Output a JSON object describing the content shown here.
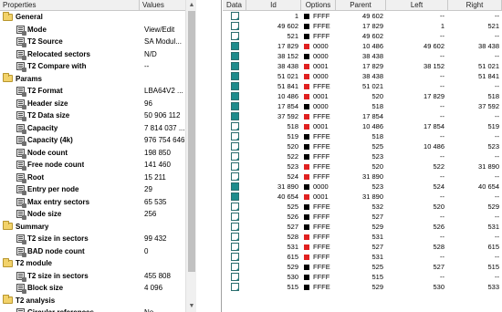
{
  "properties": {
    "header": {
      "col_name": "Properties",
      "col_value": "Values"
    },
    "rows": [
      {
        "kind": "group",
        "label": "General",
        "value": ""
      },
      {
        "kind": "item",
        "label": "Mode",
        "value": "View/Edit"
      },
      {
        "kind": "item",
        "label": "T2 Source",
        "value": "SA Modul..."
      },
      {
        "kind": "item",
        "label": "Relocated sectors",
        "value": "N/D"
      },
      {
        "kind": "item",
        "label": "T2 Compare with",
        "value": "--"
      },
      {
        "kind": "group",
        "label": "Params",
        "value": ""
      },
      {
        "kind": "item",
        "label": "T2 Format",
        "value": "LBA64V2 ..."
      },
      {
        "kind": "item",
        "label": "Header size",
        "value": "96"
      },
      {
        "kind": "item",
        "label": "T2 Data size",
        "value": "50 906 112"
      },
      {
        "kind": "item",
        "label": "Capacity",
        "value": "7 814 037 ..."
      },
      {
        "kind": "item",
        "label": "Capacity (4k)",
        "value": "976 754 646"
      },
      {
        "kind": "item",
        "label": "Node count",
        "value": "198 850"
      },
      {
        "kind": "item",
        "label": "Free node count",
        "value": "141 460"
      },
      {
        "kind": "item",
        "label": "Root",
        "value": "15 211"
      },
      {
        "kind": "item",
        "label": "Entry per node",
        "value": "29"
      },
      {
        "kind": "item",
        "label": "Max entry sectors",
        "value": "65 535"
      },
      {
        "kind": "item",
        "label": "Node size",
        "value": "256"
      },
      {
        "kind": "group",
        "label": "Summary",
        "value": ""
      },
      {
        "kind": "item",
        "label": "T2 size in sectors",
        "value": "99 432"
      },
      {
        "kind": "item",
        "label": "BAD node count",
        "value": "0"
      },
      {
        "kind": "group",
        "label": "T2 module",
        "value": ""
      },
      {
        "kind": "item",
        "label": "T2 size in sectors",
        "value": "455 808"
      },
      {
        "kind": "item",
        "label": "Block size",
        "value": "4 096"
      },
      {
        "kind": "group",
        "label": "T2 analysis",
        "value": ""
      },
      {
        "kind": "item",
        "label": "Circular references",
        "value": "No"
      }
    ]
  },
  "table": {
    "headers": {
      "data": "Data",
      "id": "Id",
      "options": "Options",
      "parent": "Parent",
      "left": "Left",
      "right": "Right"
    },
    "colors": {
      "black": "#000000",
      "red": "#e02020",
      "teal": "#1e8c8c"
    },
    "rows": [
      {
        "icon": "diag",
        "id": "1",
        "opt_color": "black",
        "opt": "FFFF",
        "parent": "49 602",
        "left": "--",
        "right": "--"
      },
      {
        "icon": "diag",
        "id": "49 602",
        "opt_color": "black",
        "opt": "FFFE",
        "parent": "17 829",
        "left": "1",
        "right": "521"
      },
      {
        "icon": "diag",
        "id": "521",
        "opt_color": "black",
        "opt": "FFFF",
        "parent": "49 602",
        "left": "--",
        "right": "--"
      },
      {
        "icon": "full",
        "id": "17 829",
        "opt_color": "red",
        "opt": "0000",
        "parent": "10 486",
        "left": "49 602",
        "right": "38 438"
      },
      {
        "icon": "full",
        "id": "38 152",
        "opt_color": "black",
        "opt": "0000",
        "parent": "38 438",
        "left": "--",
        "right": "--"
      },
      {
        "icon": "full",
        "id": "38 438",
        "opt_color": "red",
        "opt": "0001",
        "parent": "17 829",
        "left": "38 152",
        "right": "51 021"
      },
      {
        "icon": "full",
        "id": "51 021",
        "opt_color": "red",
        "opt": "0000",
        "parent": "38 438",
        "left": "--",
        "right": "51 841"
      },
      {
        "icon": "full",
        "id": "51 841",
        "opt_color": "red",
        "opt": "FFFE",
        "parent": "51 021",
        "left": "--",
        "right": "--"
      },
      {
        "icon": "full",
        "id": "10 486",
        "opt_color": "red",
        "opt": "0001",
        "parent": "520",
        "left": "17 829",
        "right": "518"
      },
      {
        "icon": "full",
        "id": "17 854",
        "opt_color": "black",
        "opt": "0000",
        "parent": "518",
        "left": "--",
        "right": "37 592"
      },
      {
        "icon": "full",
        "id": "37 592",
        "opt_color": "red",
        "opt": "FFFE",
        "parent": "17 854",
        "left": "--",
        "right": "--"
      },
      {
        "icon": "diag",
        "id": "518",
        "opt_color": "red",
        "opt": "0001",
        "parent": "10 486",
        "left": "17 854",
        "right": "519"
      },
      {
        "icon": "diag",
        "id": "519",
        "opt_color": "black",
        "opt": "FFFE",
        "parent": "518",
        "left": "--",
        "right": "--"
      },
      {
        "icon": "diag",
        "id": "520",
        "opt_color": "black",
        "opt": "FFFE",
        "parent": "525",
        "left": "10 486",
        "right": "523"
      },
      {
        "icon": "diag",
        "id": "522",
        "opt_color": "black",
        "opt": "FFFF",
        "parent": "523",
        "left": "--",
        "right": "--"
      },
      {
        "icon": "diag",
        "id": "523",
        "opt_color": "red",
        "opt": "FFFE",
        "parent": "520",
        "left": "522",
        "right": "31 890"
      },
      {
        "icon": "diag",
        "id": "524",
        "opt_color": "red",
        "opt": "FFFF",
        "parent": "31 890",
        "left": "--",
        "right": "--"
      },
      {
        "icon": "full",
        "id": "31 890",
        "opt_color": "black",
        "opt": "0000",
        "parent": "523",
        "left": "524",
        "right": "40 654"
      },
      {
        "icon": "full",
        "id": "40 654",
        "opt_color": "red",
        "opt": "0001",
        "parent": "31 890",
        "left": "--",
        "right": "--"
      },
      {
        "icon": "diag",
        "id": "525",
        "opt_color": "black",
        "opt": "FFFE",
        "parent": "532",
        "left": "520",
        "right": "529"
      },
      {
        "icon": "diag",
        "id": "526",
        "opt_color": "black",
        "opt": "FFFF",
        "parent": "527",
        "left": "--",
        "right": "--"
      },
      {
        "icon": "diag",
        "id": "527",
        "opt_color": "black",
        "opt": "FFFE",
        "parent": "529",
        "left": "526",
        "right": "531"
      },
      {
        "icon": "diag",
        "id": "528",
        "opt_color": "red",
        "opt": "FFFF",
        "parent": "531",
        "left": "--",
        "right": "--"
      },
      {
        "icon": "diag",
        "id": "531",
        "opt_color": "red",
        "opt": "FFFE",
        "parent": "527",
        "left": "528",
        "right": "615"
      },
      {
        "icon": "diag",
        "id": "615",
        "opt_color": "red",
        "opt": "FFFF",
        "parent": "531",
        "left": "--",
        "right": "--"
      },
      {
        "icon": "diag",
        "id": "529",
        "opt_color": "black",
        "opt": "FFFE",
        "parent": "525",
        "left": "527",
        "right": "515"
      },
      {
        "icon": "diag",
        "id": "530",
        "opt_color": "black",
        "opt": "FFFF",
        "parent": "515",
        "left": "--",
        "right": "--"
      },
      {
        "icon": "diag",
        "id": "515",
        "opt_color": "black",
        "opt": "FFFE",
        "parent": "529",
        "left": "530",
        "right": "533"
      }
    ]
  }
}
